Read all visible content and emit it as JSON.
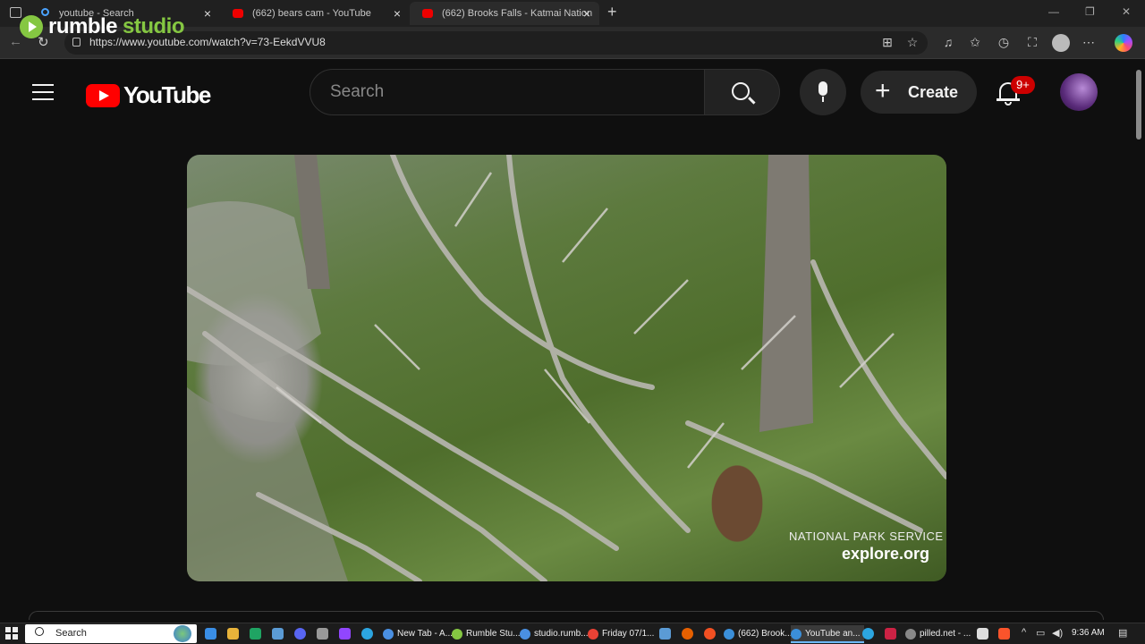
{
  "overlay": {
    "brand_part1": "rumble",
    "brand_part2": "studio",
    "brand_color": "#85c742"
  },
  "browser": {
    "tabs": [
      {
        "title": "youtube - Search",
        "icon": "search-icon",
        "active": false
      },
      {
        "title": "(662) bears cam - YouTube",
        "icon": "youtube-icon",
        "active": false
      },
      {
        "title": "(662) Brooks Falls - Katmai Nation",
        "icon": "youtube-icon",
        "active": true
      }
    ],
    "url": "https://www.youtube.com/watch?v=73-EekdVVU8"
  },
  "youtube": {
    "logo_text": "YouTube",
    "search_placeholder": "Search",
    "create_label": "Create",
    "notification_badge": "9+",
    "accent": "#ff0000"
  },
  "video": {
    "watermark_line1": "NATIONAL PARK SERVICE",
    "watermark_line2": "explore.org"
  },
  "taskbar": {
    "search_label": "Search",
    "apps": [
      {
        "label": "New Tab - A...",
        "color": "#4a90e2"
      },
      {
        "label": "Rumble Stu...",
        "color": "#85c742"
      },
      {
        "label": "studio.rumb...",
        "color": "#4a90e2"
      },
      {
        "label": "Friday 07/1...",
        "color": "#e94235"
      },
      {
        "label": "(662) Brook...",
        "color": "#3b8fd9"
      },
      {
        "label": "YouTube an...",
        "color": "#3b8fd9",
        "active": true
      },
      {
        "label": "pilled.net - ...",
        "color": "#888888"
      }
    ],
    "time": "9:36 AM"
  }
}
